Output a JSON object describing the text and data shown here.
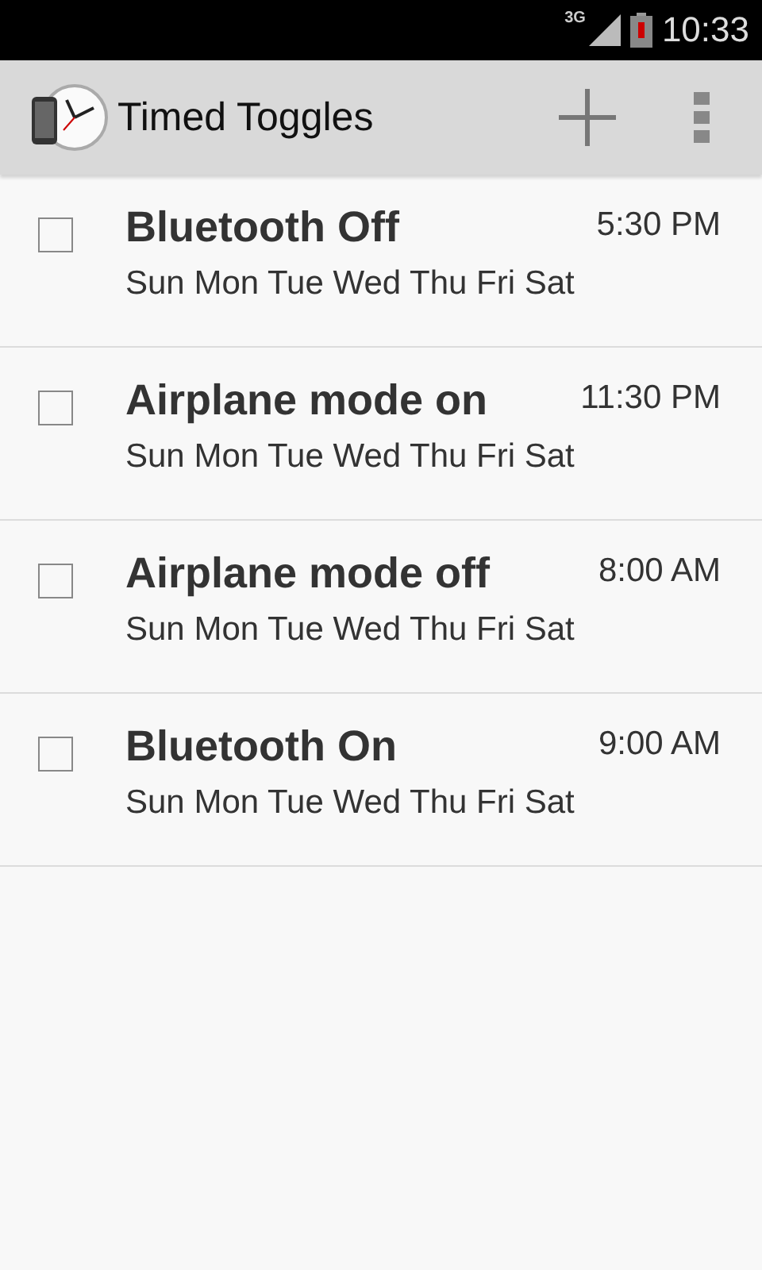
{
  "status_bar": {
    "network": "3G",
    "time": "10:33"
  },
  "action_bar": {
    "title": "Timed Toggles"
  },
  "toggles": [
    {
      "name": "Bluetooth Off",
      "time": "5:30 PM",
      "days": "Sun Mon Tue Wed Thu Fri Sat",
      "checked": false
    },
    {
      "name": "Airplane mode on",
      "time": "11:30 PM",
      "days": "Sun Mon Tue Wed Thu Fri Sat",
      "checked": false
    },
    {
      "name": "Airplane mode off",
      "time": "8:00 AM",
      "days": "Sun Mon Tue Wed Thu Fri Sat",
      "checked": false
    },
    {
      "name": "Bluetooth On",
      "time": "9:00 AM",
      "days": "Sun Mon Tue Wed Thu Fri Sat",
      "checked": false
    }
  ]
}
